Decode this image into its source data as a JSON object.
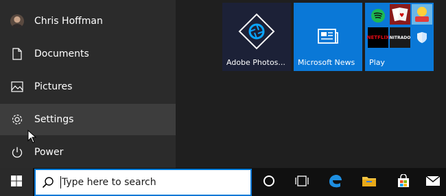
{
  "start_menu": {
    "user": {
      "name": "Chris Hoffman"
    },
    "rail_items": [
      {
        "label": "Documents",
        "icon": "document-icon"
      },
      {
        "label": "Pictures",
        "icon": "pictures-icon"
      },
      {
        "label": "Settings",
        "icon": "gear-icon"
      },
      {
        "label": "Power",
        "icon": "power-icon"
      }
    ],
    "tiles": [
      {
        "label": "Adobe Photos...",
        "icon": "adobe-photoshop-express-icon"
      },
      {
        "label": "Microsoft News",
        "icon": "news-icon"
      },
      {
        "label": "Play",
        "apps": [
          "Spotify",
          "Solitaire",
          "Friends",
          "NETFLIX",
          "NITRADO",
          "Shield"
        ]
      }
    ]
  },
  "taskbar": {
    "search_placeholder": "Type here to search",
    "icons": [
      "windows-logo-icon",
      "search-icon",
      "cortana-icon",
      "task-view-icon",
      "edge-icon",
      "file-explorer-icon",
      "store-icon",
      "mail-icon"
    ]
  },
  "colors": {
    "accent": "#0078d7",
    "tile_blue": "#0a78d7",
    "photoshop_tile": "#1c2137"
  }
}
